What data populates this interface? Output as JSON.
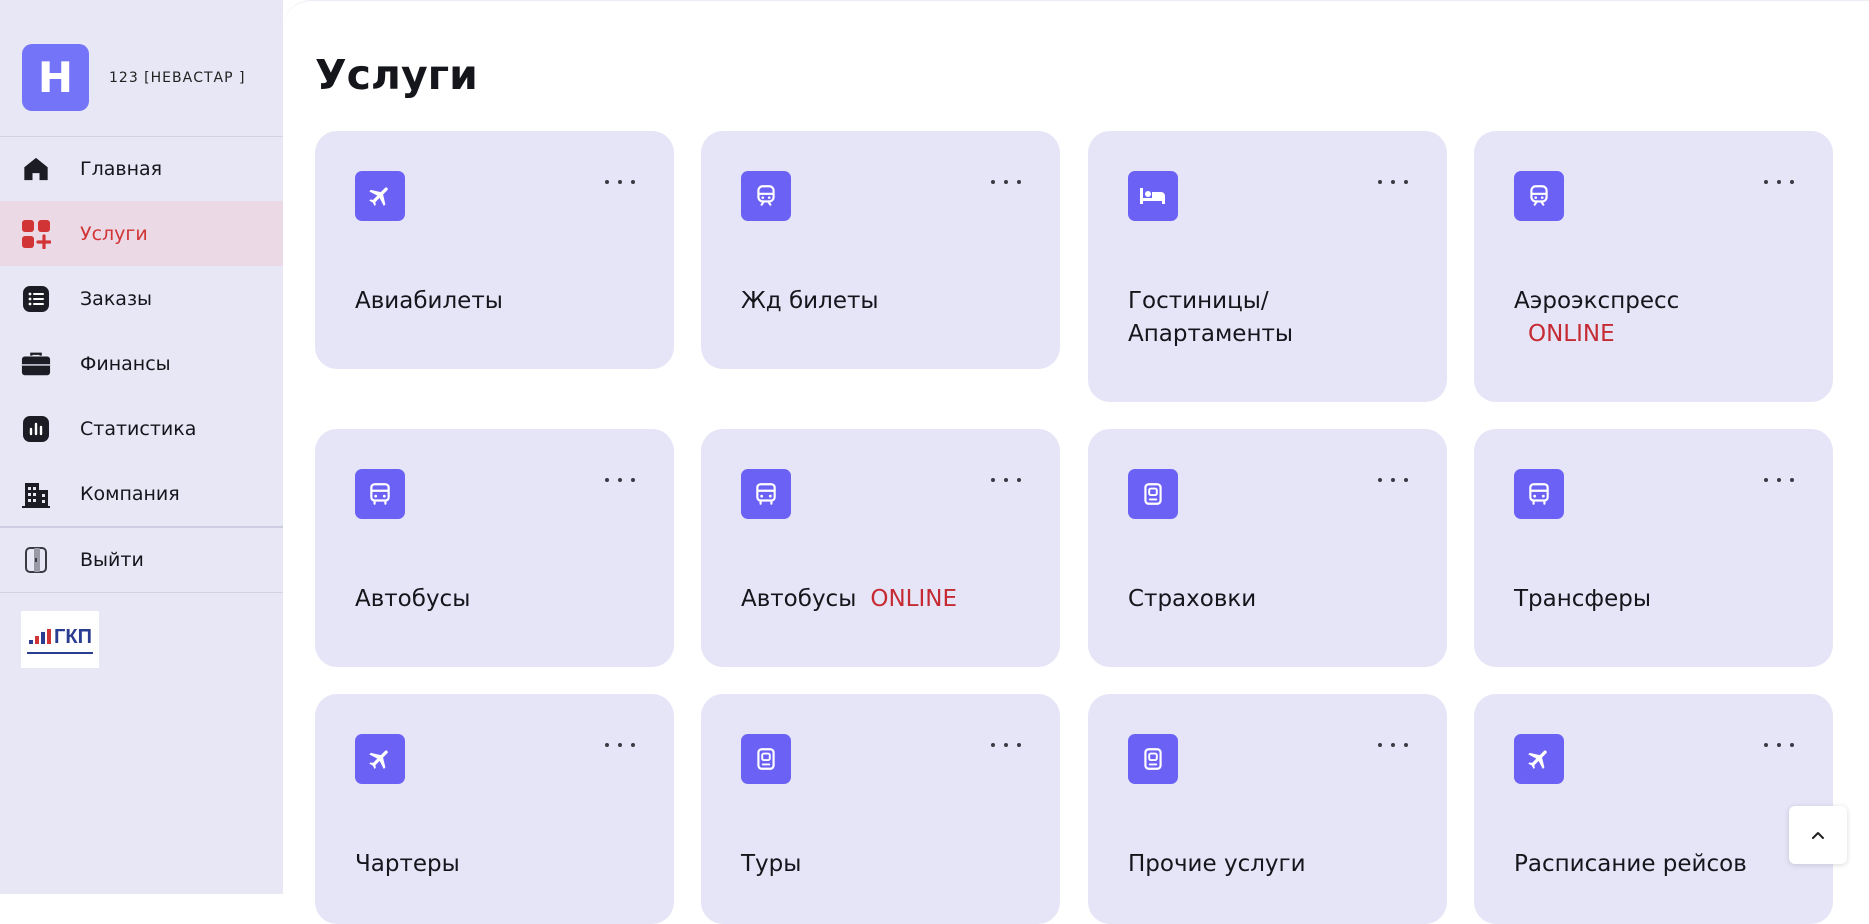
{
  "profile": {
    "avatar_letter": "Н",
    "name": "123 [НЕВАСТАР ]"
  },
  "nav": {
    "items": [
      {
        "label": "Главная",
        "icon": "home-icon"
      },
      {
        "label": "Услуги",
        "icon": "services-icon",
        "active": true
      },
      {
        "label": "Заказы",
        "icon": "orders-list-icon"
      },
      {
        "label": "Финансы",
        "icon": "briefcase-icon"
      },
      {
        "label": "Статистика",
        "icon": "chart-icon"
      },
      {
        "label": "Компания",
        "icon": "building-icon"
      }
    ],
    "logout_label": "Выйти"
  },
  "logo": {
    "text": "ГКП"
  },
  "page": {
    "title": "Услуги"
  },
  "cards": [
    {
      "title": "Авиабилеты",
      "icon": "plane-icon"
    },
    {
      "title": "Жд билеты",
      "icon": "train-icon"
    },
    {
      "title_line1": "Гостиницы/",
      "title_line2": "Апартаменты",
      "icon": "bed-icon"
    },
    {
      "title": "Аэроэкспресс",
      "badge": "ONLINE",
      "icon": "train-icon"
    },
    {
      "title": "Автобусы",
      "icon": "bus-icon"
    },
    {
      "title": "Автобусы",
      "badge": "ONLINE",
      "icon": "bus-icon"
    },
    {
      "title": "Страховки",
      "icon": "passport-icon"
    },
    {
      "title": "Трансферы",
      "icon": "bus-icon"
    },
    {
      "title": "Чартеры",
      "icon": "plane-icon"
    },
    {
      "title": "Туры",
      "icon": "passport-icon"
    },
    {
      "title": "Прочие услуги",
      "icon": "passport-icon"
    },
    {
      "title": "Расписание рейсов",
      "icon": "plane-icon"
    }
  ],
  "colors": {
    "accent": "#6c61f5",
    "card_bg": "#e5e5f7",
    "sidebar_bg": "#e7e7f6",
    "active_bg": "#ebd9e6",
    "active_text": "#d23535",
    "online": "#c62b33"
  }
}
